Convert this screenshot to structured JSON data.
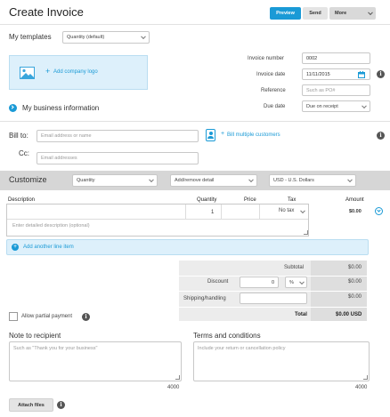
{
  "header": {
    "title": "Create Invoice",
    "preview_label": "Preview",
    "send_label": "Send",
    "more_label": "More"
  },
  "templates": {
    "label": "My templates",
    "selected": "Quantity (default)"
  },
  "logo": {
    "label": "Add company logo"
  },
  "business": {
    "label": "My business information"
  },
  "invoice_meta": {
    "number_label": "Invoice number",
    "number_value": "0002",
    "date_label": "Invoice date",
    "date_value": "11/11/2015",
    "reference_label": "Reference",
    "reference_placeholder": "Such as PO#",
    "due_label": "Due date",
    "due_value": "Due on receipt"
  },
  "billing": {
    "bill_to_label": "Bill to:",
    "bill_to_placeholder": "Email address or name",
    "bill_multiple": "Bill multiple customers",
    "cc_label": "Cc:",
    "cc_placeholder": "Email addresses"
  },
  "customize": {
    "label": "Customize",
    "quantity": "Quantity",
    "detail": "Add/remove detail",
    "currency": "USD - U.S. Dollars"
  },
  "items": {
    "headers": {
      "description": "Description",
      "quantity": "Quantity",
      "price": "Price",
      "tax": "Tax",
      "amount": "Amount"
    },
    "row": {
      "quantity": "1",
      "tax": "No tax",
      "amount": "$0.00",
      "detail_placeholder": "Enter detailed description (optional)"
    },
    "add_line": "Add another line item"
  },
  "totals": {
    "subtotal_label": "Subtotal",
    "subtotal_value": "$0.00",
    "discount_label": "Discount",
    "discount_input": "0",
    "discount_unit": "%",
    "discount_value": "$0.00",
    "shipping_label": "Shipping/handling",
    "shipping_value": "$0.00",
    "total_label": "Total",
    "total_value": "$0.00 USD"
  },
  "partial_payment": {
    "label": "Allow partial payment"
  },
  "note": {
    "label": "Note to recipient",
    "placeholder": "Such as \"Thank you for your business\"",
    "counter": "4000"
  },
  "terms": {
    "label": "Terms and conditions",
    "placeholder": "Include your return or cancellation policy",
    "counter": "4000"
  },
  "attach": {
    "label": "Attach files"
  },
  "colors": {
    "accent": "#1a9ad6",
    "logo_bg": "#ddf0fb",
    "gray_band": "#d6d6d6"
  }
}
